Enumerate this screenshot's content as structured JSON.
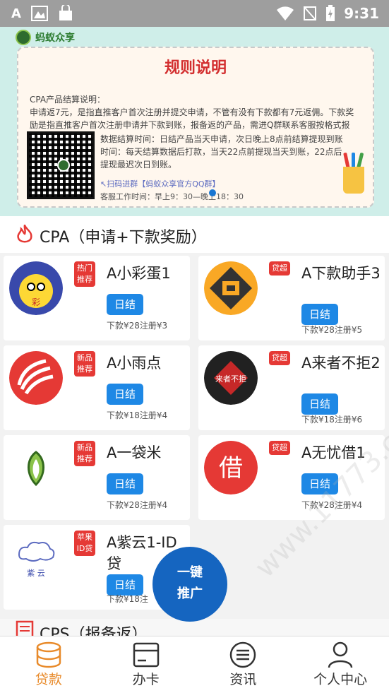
{
  "status_bar": {
    "left_glyph": "A",
    "time": "9:31"
  },
  "banner": {
    "brand": "蚂蚁众享",
    "title": "规则说明",
    "rules_heading": "CPA产品结算说明：",
    "rules_line1": "申请返7元，是指直推客户首次注册并提交申请，不管有没有下款都有7元返佣。下款奖励是指直推客户首次注册申请并下款到账，报备返的产品，需进Q群联系客服按格式报备。",
    "rules_line2": "数据结算时间：日结产品当天申请，次日晚上8点前结算提现到账时间：每天结算数据后打款，当天22点前提现当天到账，22点后提现最迟次日到账。",
    "scan_text": "↖扫码进群【蚂蚁众享官方QQ群】",
    "work_hours": "客服工作时间：早上9：30—晚上18：30"
  },
  "section": {
    "title": "CPA（申请+下款奖励）"
  },
  "products": [
    {
      "name": "A小彩蛋1",
      "badge": "热门推荐",
      "settle": "日结",
      "reward": "下款¥28注册¥3"
    },
    {
      "name": "A下款助手3",
      "badge": "贷超",
      "settle": "日结",
      "reward": "下款¥28注册¥5"
    },
    {
      "name": "A小雨点",
      "badge": "新品推荐",
      "settle": "日结",
      "reward": "下款¥18注册¥4"
    },
    {
      "name": "A来者不拒2",
      "badge": "贷超",
      "settle": "日结",
      "reward": "下款¥18注册¥6",
      "icon_text": "来者不拒"
    },
    {
      "name": "A一袋米",
      "badge": "新品推荐",
      "settle": "日结",
      "reward": "下款¥28注册¥4"
    },
    {
      "name": "A无忧借1",
      "badge": "贷超",
      "settle": "日结",
      "reward": "下款¥28注册¥4",
      "icon_text": "借"
    },
    {
      "name": "A紫云1-ID贷",
      "badge": "苹果ID贷",
      "settle": "日结",
      "reward": "下款¥18注",
      "icon_text": "紫 云"
    }
  ],
  "fab": {
    "line1": "一键",
    "line2": "推广"
  },
  "cps": {
    "title": "CPS（报备返）"
  },
  "tabs": [
    {
      "label": "贷款",
      "icon": "database-icon",
      "active": true
    },
    {
      "label": "办卡",
      "icon": "card-icon",
      "active": false
    },
    {
      "label": "资讯",
      "icon": "list-icon",
      "active": false
    },
    {
      "label": "个人中心",
      "icon": "person-icon",
      "active": false
    }
  ],
  "watermark": "www.11773.com",
  "watermark2": "11773.com",
  "colors": {
    "accent": "#1e88e5",
    "badge": "#e53935",
    "active_tab": "#e88a2a",
    "title_red": "#d32f2f"
  }
}
